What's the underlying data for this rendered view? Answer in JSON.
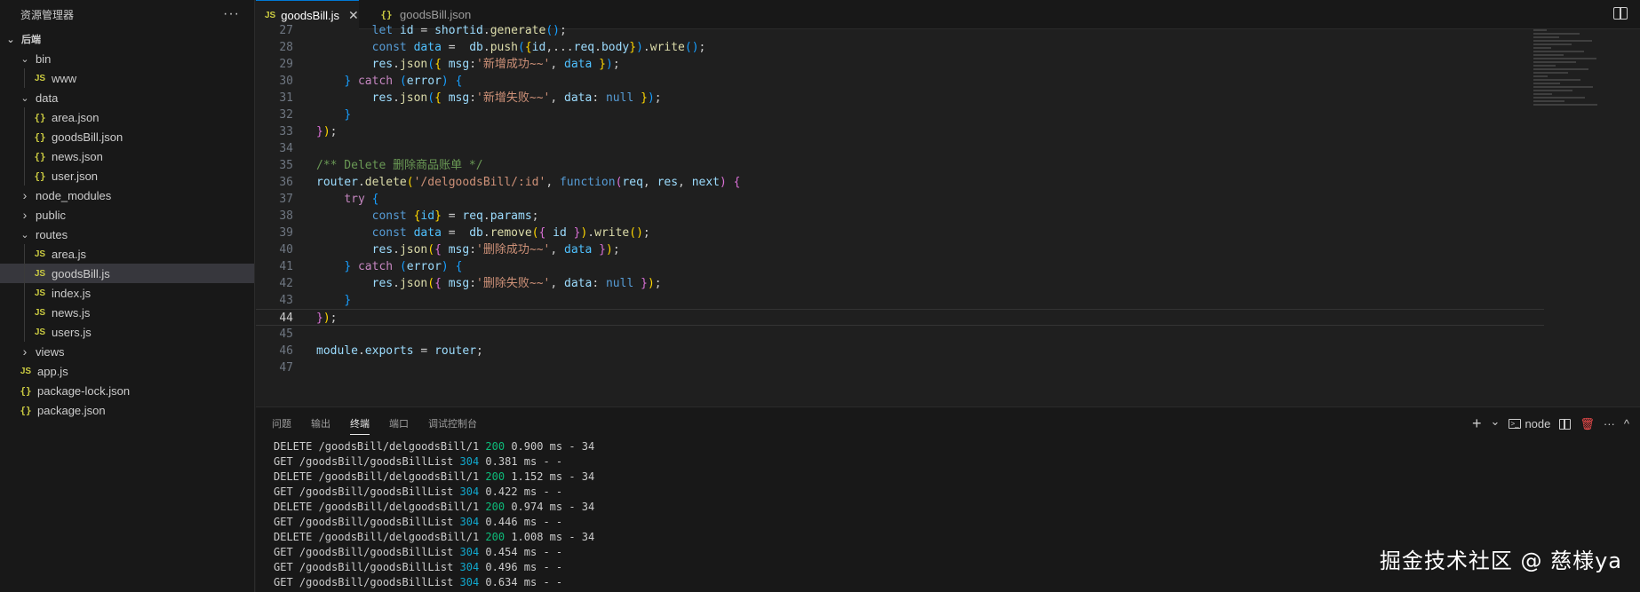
{
  "explorer": {
    "title": "资源管理器",
    "more": "···",
    "items": [
      {
        "label": "后端",
        "kind": "folder-open",
        "depth": 0,
        "root": true
      },
      {
        "label": "bin",
        "kind": "folder-open",
        "depth": 1
      },
      {
        "label": "www",
        "kind": "js",
        "depth": 2
      },
      {
        "label": "data",
        "kind": "folder-open",
        "depth": 1
      },
      {
        "label": "area.json",
        "kind": "json",
        "depth": 2
      },
      {
        "label": "goodsBill.json",
        "kind": "json",
        "depth": 2
      },
      {
        "label": "news.json",
        "kind": "json",
        "depth": 2
      },
      {
        "label": "user.json",
        "kind": "json",
        "depth": 2
      },
      {
        "label": "node_modules",
        "kind": "folder-closed",
        "depth": 1
      },
      {
        "label": "public",
        "kind": "folder-closed",
        "depth": 1
      },
      {
        "label": "routes",
        "kind": "folder-open",
        "depth": 1
      },
      {
        "label": "area.js",
        "kind": "js",
        "depth": 2
      },
      {
        "label": "goodsBill.js",
        "kind": "js",
        "depth": 2,
        "selected": true
      },
      {
        "label": "index.js",
        "kind": "js",
        "depth": 2
      },
      {
        "label": "news.js",
        "kind": "js",
        "depth": 2
      },
      {
        "label": "users.js",
        "kind": "js",
        "depth": 2
      },
      {
        "label": "views",
        "kind": "folder-closed",
        "depth": 1
      },
      {
        "label": "app.js",
        "kind": "js",
        "depth": 1
      },
      {
        "label": "package-lock.json",
        "kind": "json",
        "depth": 1
      },
      {
        "label": "package.json",
        "kind": "json",
        "depth": 1
      }
    ],
    "icons": {
      "js": "JS",
      "json": "{}",
      "open": "⌄",
      "closed": "›"
    }
  },
  "tabs": [
    {
      "label": "goodsBill.js",
      "icon": "JS",
      "active": true,
      "close": "✕"
    },
    {
      "label": "goodsBill.json",
      "icon": "{}",
      "active": false
    }
  ],
  "editor": {
    "current_line": 44,
    "lines": [
      {
        "n": "27",
        "t": [
          [
            "        ",
            "pn"
          ],
          [
            "let",
            "kw"
          ],
          [
            " ",
            "pn"
          ],
          [
            "id",
            "var"
          ],
          [
            " = ",
            "pn"
          ],
          [
            "shortid",
            "var"
          ],
          [
            ".",
            "pn"
          ],
          [
            "generate",
            "fn"
          ],
          [
            "()",
            "br3"
          ],
          [
            ";",
            "pn"
          ]
        ]
      },
      {
        "n": "28",
        "t": [
          [
            "        ",
            "pn"
          ],
          [
            "const",
            "kw"
          ],
          [
            " ",
            "pn"
          ],
          [
            "data",
            "cst"
          ],
          [
            " =  ",
            "pn"
          ],
          [
            "db",
            "var"
          ],
          [
            ".",
            "pn"
          ],
          [
            "push",
            "fn"
          ],
          [
            "(",
            "br3"
          ],
          [
            "{",
            "br1"
          ],
          [
            "id",
            "var"
          ],
          [
            ",...",
            "pn"
          ],
          [
            "req",
            "var"
          ],
          [
            ".",
            "pn"
          ],
          [
            "body",
            "var"
          ],
          [
            "}",
            "br1"
          ],
          [
            ")",
            "br3"
          ],
          [
            ".",
            "pn"
          ],
          [
            "write",
            "fn"
          ],
          [
            "()",
            "br3"
          ],
          [
            ";",
            "pn"
          ]
        ]
      },
      {
        "n": "29",
        "t": [
          [
            "        ",
            "pn"
          ],
          [
            "res",
            "var"
          ],
          [
            ".",
            "pn"
          ],
          [
            "json",
            "fn"
          ],
          [
            "(",
            "br3"
          ],
          [
            "{",
            "br1"
          ],
          [
            " ",
            "pn"
          ],
          [
            "msg",
            "var"
          ],
          [
            ":",
            "pn"
          ],
          [
            "'新增成功~~'",
            "str"
          ],
          [
            ", ",
            "pn"
          ],
          [
            "data",
            "cst"
          ],
          [
            " ",
            "pn"
          ],
          [
            "}",
            "br1"
          ],
          [
            ")",
            "br3"
          ],
          [
            ";",
            "pn"
          ]
        ]
      },
      {
        "n": "30",
        "t": [
          [
            "    ",
            "pn"
          ],
          [
            "}",
            "br3"
          ],
          [
            " ",
            "pn"
          ],
          [
            "catch",
            "ctl"
          ],
          [
            " ",
            "pn"
          ],
          [
            "(",
            "br3"
          ],
          [
            "error",
            "var"
          ],
          [
            ")",
            "br3"
          ],
          [
            " ",
            "pn"
          ],
          [
            "{",
            "br3"
          ]
        ]
      },
      {
        "n": "31",
        "t": [
          [
            "        ",
            "pn"
          ],
          [
            "res",
            "var"
          ],
          [
            ".",
            "pn"
          ],
          [
            "json",
            "fn"
          ],
          [
            "(",
            "br3"
          ],
          [
            "{",
            "br1"
          ],
          [
            " ",
            "pn"
          ],
          [
            "msg",
            "var"
          ],
          [
            ":",
            "pn"
          ],
          [
            "'新增失败~~'",
            "str"
          ],
          [
            ", ",
            "pn"
          ],
          [
            "data",
            "var"
          ],
          [
            ": ",
            "pn"
          ],
          [
            "null",
            "kw"
          ],
          [
            " ",
            "pn"
          ],
          [
            "}",
            "br1"
          ],
          [
            ")",
            "br3"
          ],
          [
            ";",
            "pn"
          ]
        ]
      },
      {
        "n": "32",
        "t": [
          [
            "    ",
            "pn"
          ],
          [
            "}",
            "br3"
          ]
        ]
      },
      {
        "n": "33",
        "t": [
          [
            "}",
            "br2"
          ],
          [
            ")",
            "br1"
          ],
          [
            ";",
            "pn"
          ]
        ]
      },
      {
        "n": "34",
        "t": []
      },
      {
        "n": "35",
        "t": [
          [
            "/** Delete 删除商品账单 */",
            "cmt"
          ]
        ]
      },
      {
        "n": "36",
        "t": [
          [
            "router",
            "var"
          ],
          [
            ".",
            "pn"
          ],
          [
            "delete",
            "fn"
          ],
          [
            "(",
            "br1"
          ],
          [
            "'/delgoodsBill/:id'",
            "str"
          ],
          [
            ", ",
            "pn"
          ],
          [
            "function",
            "kw"
          ],
          [
            "(",
            "br2"
          ],
          [
            "req",
            "var"
          ],
          [
            ", ",
            "pn"
          ],
          [
            "res",
            "var"
          ],
          [
            ", ",
            "pn"
          ],
          [
            "next",
            "var"
          ],
          [
            ")",
            "br2"
          ],
          [
            " ",
            "pn"
          ],
          [
            "{",
            "br2"
          ]
        ]
      },
      {
        "n": "37",
        "t": [
          [
            "    ",
            "pn"
          ],
          [
            "try",
            "ctl"
          ],
          [
            " ",
            "pn"
          ],
          [
            "{",
            "br3"
          ]
        ]
      },
      {
        "n": "38",
        "t": [
          [
            "        ",
            "pn"
          ],
          [
            "const",
            "kw"
          ],
          [
            " ",
            "pn"
          ],
          [
            "{",
            "br1"
          ],
          [
            "id",
            "cst"
          ],
          [
            "}",
            "br1"
          ],
          [
            " = ",
            "pn"
          ],
          [
            "req",
            "var"
          ],
          [
            ".",
            "pn"
          ],
          [
            "params",
            "var"
          ],
          [
            ";",
            "pn"
          ]
        ]
      },
      {
        "n": "39",
        "t": [
          [
            "        ",
            "pn"
          ],
          [
            "const",
            "kw"
          ],
          [
            " ",
            "pn"
          ],
          [
            "data",
            "cst"
          ],
          [
            " =  ",
            "pn"
          ],
          [
            "db",
            "var"
          ],
          [
            ".",
            "pn"
          ],
          [
            "remove",
            "fn"
          ],
          [
            "(",
            "br1"
          ],
          [
            "{",
            "br2"
          ],
          [
            " ",
            "pn"
          ],
          [
            "id",
            "var"
          ],
          [
            " ",
            "pn"
          ],
          [
            "}",
            "br2"
          ],
          [
            ")",
            "br1"
          ],
          [
            ".",
            "pn"
          ],
          [
            "write",
            "fn"
          ],
          [
            "()",
            "br1"
          ],
          [
            ";",
            "pn"
          ]
        ]
      },
      {
        "n": "40",
        "t": [
          [
            "        ",
            "pn"
          ],
          [
            "res",
            "var"
          ],
          [
            ".",
            "pn"
          ],
          [
            "json",
            "fn"
          ],
          [
            "(",
            "br1"
          ],
          [
            "{",
            "br2"
          ],
          [
            " ",
            "pn"
          ],
          [
            "msg",
            "var"
          ],
          [
            ":",
            "pn"
          ],
          [
            "'删除成功~~'",
            "str"
          ],
          [
            ", ",
            "pn"
          ],
          [
            "data",
            "cst"
          ],
          [
            " ",
            "pn"
          ],
          [
            "}",
            "br2"
          ],
          [
            ")",
            "br1"
          ],
          [
            ";",
            "pn"
          ]
        ]
      },
      {
        "n": "41",
        "t": [
          [
            "    ",
            "pn"
          ],
          [
            "}",
            "br3"
          ],
          [
            " ",
            "pn"
          ],
          [
            "catch",
            "ctl"
          ],
          [
            " ",
            "pn"
          ],
          [
            "(",
            "br3"
          ],
          [
            "error",
            "var"
          ],
          [
            ")",
            "br3"
          ],
          [
            " ",
            "pn"
          ],
          [
            "{",
            "br3"
          ]
        ]
      },
      {
        "n": "42",
        "t": [
          [
            "        ",
            "pn"
          ],
          [
            "res",
            "var"
          ],
          [
            ".",
            "pn"
          ],
          [
            "json",
            "fn"
          ],
          [
            "(",
            "br1"
          ],
          [
            "{",
            "br2"
          ],
          [
            " ",
            "pn"
          ],
          [
            "msg",
            "var"
          ],
          [
            ":",
            "pn"
          ],
          [
            "'删除失败~~'",
            "str"
          ],
          [
            ", ",
            "pn"
          ],
          [
            "data",
            "var"
          ],
          [
            ": ",
            "pn"
          ],
          [
            "null",
            "kw"
          ],
          [
            " ",
            "pn"
          ],
          [
            "}",
            "br2"
          ],
          [
            ")",
            "br1"
          ],
          [
            ";",
            "pn"
          ]
        ]
      },
      {
        "n": "43",
        "t": [
          [
            "    ",
            "pn"
          ],
          [
            "}",
            "br3"
          ]
        ]
      },
      {
        "n": "44",
        "t": [
          [
            "}",
            "br2"
          ],
          [
            ")",
            "br1"
          ],
          [
            ";",
            "pn"
          ]
        ]
      },
      {
        "n": "45",
        "t": []
      },
      {
        "n": "46",
        "t": [
          [
            "module",
            "var"
          ],
          [
            ".",
            "pn"
          ],
          [
            "exports",
            "var"
          ],
          [
            " = ",
            "pn"
          ],
          [
            "router",
            "var"
          ],
          [
            ";",
            "pn"
          ]
        ]
      },
      {
        "n": "47",
        "t": []
      }
    ]
  },
  "panel": {
    "tabs": [
      {
        "label": "问题",
        "active": false
      },
      {
        "label": "输出",
        "active": false
      },
      {
        "label": "终端",
        "active": true
      },
      {
        "label": "端口",
        "active": false
      },
      {
        "label": "调试控制台",
        "active": false
      }
    ],
    "actions": {
      "add": "+",
      "dropdown": "⌄",
      "shell": "node",
      "more": "···",
      "maximize": "^"
    },
    "terminal": [
      {
        "pre": "DELETE /goodsBill/delgoodsBill/1 ",
        "status": "200",
        "post": " 0.900 ms - 34"
      },
      {
        "pre": "GET /goodsBill/goodsBillList ",
        "status": "304",
        "post": " 0.381 ms - -"
      },
      {
        "pre": "DELETE /goodsBill/delgoodsBill/1 ",
        "status": "200",
        "post": " 1.152 ms - 34"
      },
      {
        "pre": "GET /goodsBill/goodsBillList ",
        "status": "304",
        "post": " 0.422 ms - -"
      },
      {
        "pre": "DELETE /goodsBill/delgoodsBill/1 ",
        "status": "200",
        "post": " 0.974 ms - 34"
      },
      {
        "pre": "GET /goodsBill/goodsBillList ",
        "status": "304",
        "post": " 0.446 ms - -"
      },
      {
        "pre": "DELETE /goodsBill/delgoodsBill/1 ",
        "status": "200",
        "post": " 1.008 ms - 34"
      },
      {
        "pre": "GET /goodsBill/goodsBillList ",
        "status": "304",
        "post": " 0.454 ms - -"
      },
      {
        "pre": "GET /goodsBill/goodsBillList ",
        "status": "304",
        "post": " 0.496 ms - -"
      },
      {
        "pre": "GET /goodsBill/goodsBillList ",
        "status": "304",
        "post": " 0.634 ms - -"
      }
    ]
  },
  "watermark": "掘金技术社区 @ 慈様ya",
  "colors": {
    "accent": "#0078d4",
    "status_200": "#0dbc79",
    "status_304": "#11a8cd"
  }
}
